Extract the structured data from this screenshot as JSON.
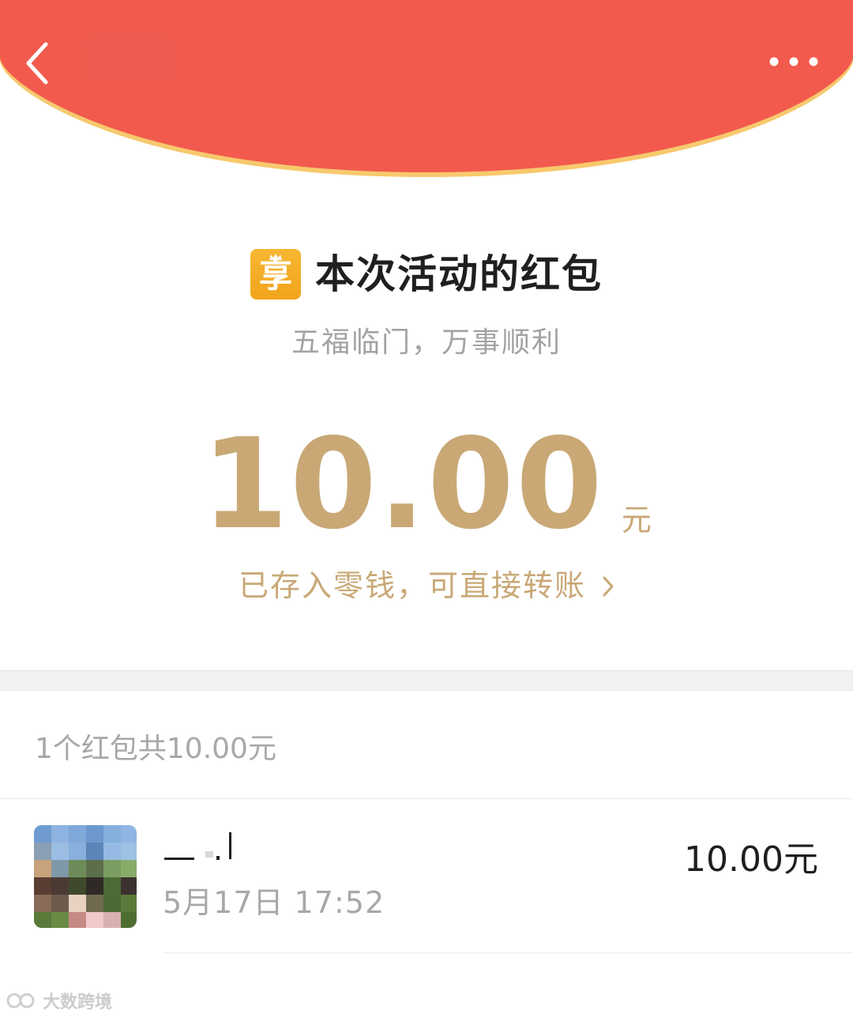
{
  "header": {
    "back_icon": "chevron-left-icon",
    "more_icon": "more-dots-icon",
    "background_color": "#f25a4e",
    "rim_color": "#f7c96d"
  },
  "sender": {
    "logo_glyph": "享",
    "logo_color": "#f3a722",
    "title": "本次活动的红包"
  },
  "blessing": "五福临门，万事顺利",
  "amount": {
    "value": "10.00",
    "unit": "元",
    "color": "#c9a876"
  },
  "wallet_link": {
    "label": "已存入零钱，可直接转账",
    "chevron_icon": "chevron-right-icon"
  },
  "summary": "1个红包共10.00元",
  "records": [
    {
      "avatar": "avatar-image",
      "time": "5月17日  17:52",
      "amount": "10.00元"
    }
  ],
  "watermark": {
    "text": "大数跨境"
  }
}
